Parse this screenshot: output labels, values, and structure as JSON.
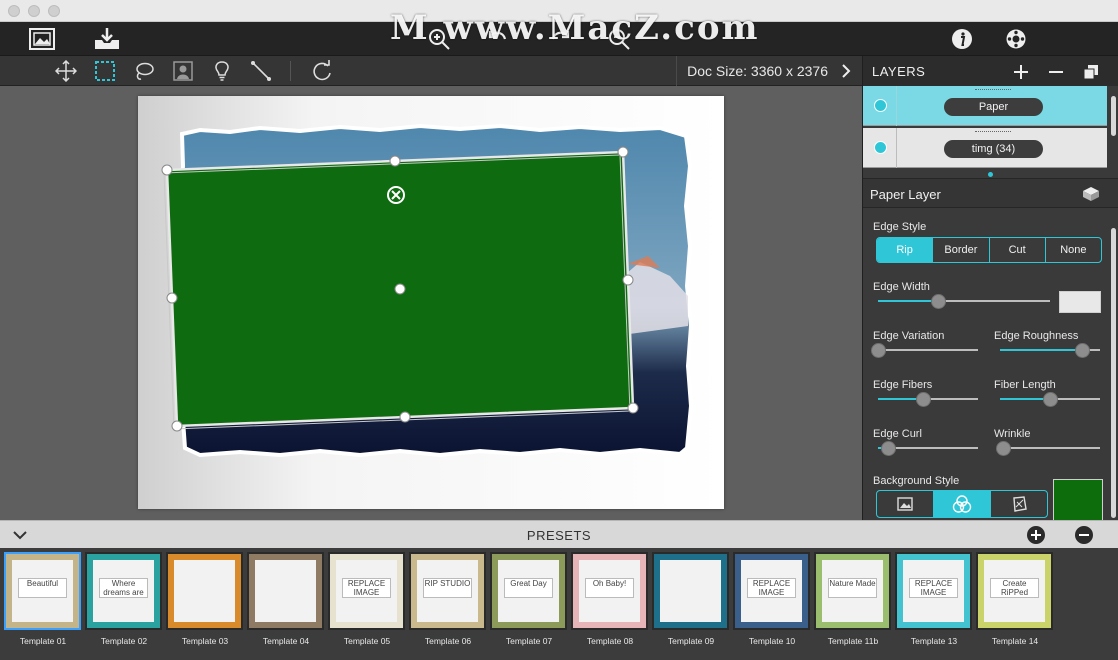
{
  "window": {
    "watermark": "M www.MacZ.com"
  },
  "toolbar": {
    "doc_size_label": "Doc Size:",
    "doc_size_value": "3360 x 2376"
  },
  "layers": {
    "title": "LAYERS",
    "items": [
      {
        "label": "Paper",
        "selected": true
      },
      {
        "label": "timg (34)",
        "selected": false
      }
    ]
  },
  "paper_layer": {
    "title": "Paper Layer",
    "edge_style": {
      "label": "Edge Style",
      "options": [
        "Rip",
        "Border",
        "Cut",
        "None"
      ],
      "selected": "Rip"
    },
    "edge_width": {
      "label": "Edge Width",
      "value": 0.35
    },
    "edge_variation": {
      "label": "Edge Variation",
      "value": 0.0
    },
    "edge_roughness": {
      "label": "Edge Roughness",
      "value": 0.82
    },
    "edge_fibers": {
      "label": "Edge Fibers",
      "value": 0.45
    },
    "fiber_length": {
      "label": "Fiber Length",
      "value": 0.5
    },
    "edge_curl": {
      "label": "Edge Curl",
      "value": 0.1
    },
    "wrinkle": {
      "label": "Wrinkle",
      "value": 0.03
    },
    "background_style": {
      "label": "Background Style",
      "selected": 1
    }
  },
  "presets": {
    "title": "PRESETS",
    "templates": [
      {
        "label": "Template 01",
        "text": "Beautiful",
        "color": "#c4b48a"
      },
      {
        "label": "Template 02",
        "text": "Where dreams are Made",
        "color": "#2aa2a0"
      },
      {
        "label": "Template 03",
        "text": "",
        "color": "#d98a2b"
      },
      {
        "label": "Template 04",
        "text": "",
        "color": "#8f7a63"
      },
      {
        "label": "Template 05",
        "text": "REPLACE IMAGE",
        "color": "#e7e2cf"
      },
      {
        "label": "Template 06",
        "text": "RIP STUDIO",
        "color": "#c9b98d"
      },
      {
        "label": "Template 07",
        "text": "Great Day",
        "color": "#8c9a5a"
      },
      {
        "label": "Template 08",
        "text": "Oh Baby!",
        "color": "#e7b4b7"
      },
      {
        "label": "Template 09",
        "text": "",
        "color": "#1e6f8a"
      },
      {
        "label": "Template 10",
        "text": "REPLACE IMAGE",
        "color": "#3a5f8a"
      },
      {
        "label": "Template 11b",
        "text": "Nature Made",
        "color": "#9bbd6e"
      },
      {
        "label": "Template 13",
        "text": "REPLACE IMAGE",
        "color": "#42c3cf"
      },
      {
        "label": "Template 14",
        "text": "Create RiPPed",
        "color": "#c9d36a"
      }
    ]
  },
  "colors": {
    "accent": "#2fc7d8",
    "selection_green": "#0e6b10",
    "background_swatch": "#0d6d0d"
  }
}
